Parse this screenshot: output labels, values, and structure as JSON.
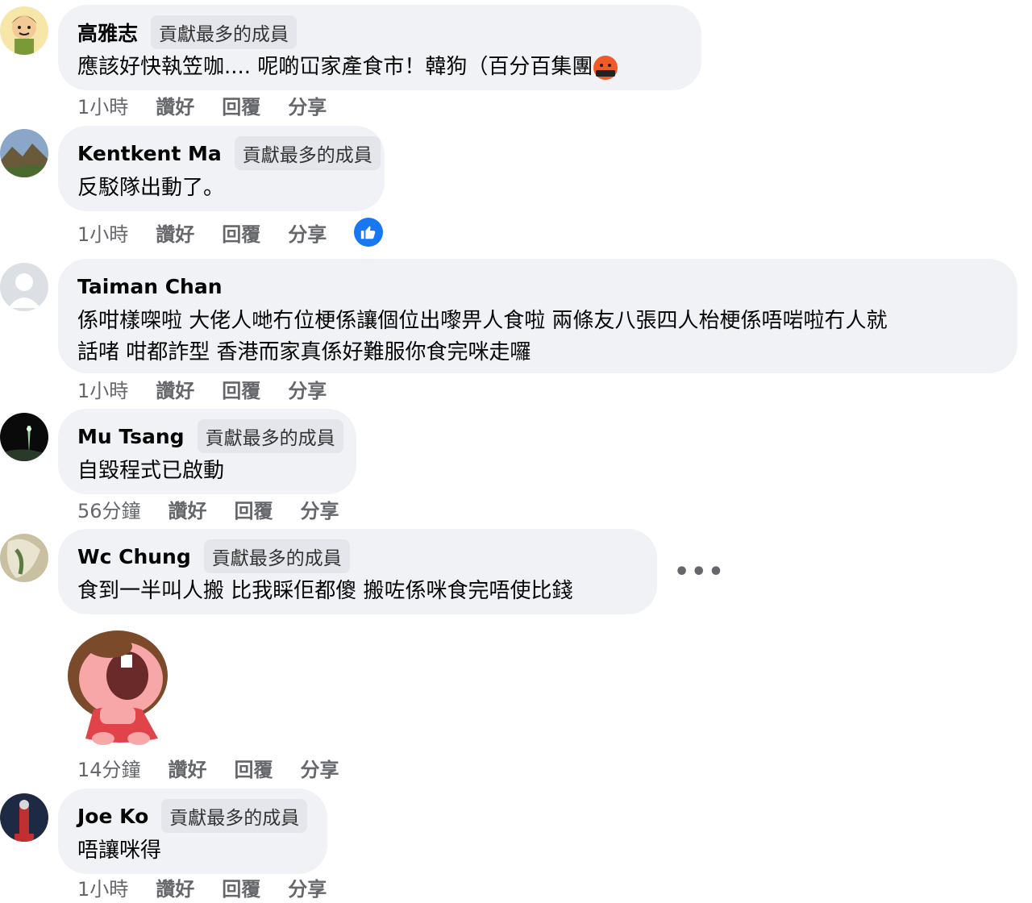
{
  "comments": [
    {
      "name": "高雅志",
      "badge": "貢獻最多的成員",
      "text": "應該好快執笠咖.... 呢啲冚家產食市！韓狗（百分百集團",
      "emoji_icon": "angry-censored-face-icon",
      "time": "1小時",
      "like": "讚好",
      "reply": "回覆",
      "share": "分享"
    },
    {
      "name": "Kentkent Ma",
      "badge": "貢獻最多的成員",
      "text": "反駁隊出動了。",
      "time": "1小時",
      "like": "讚好",
      "reply": "回覆",
      "share": "分享",
      "reaction_icon": "thumbs-up-icon"
    },
    {
      "name": "Taiman Chan",
      "text_lines": [
        "係咁樣㗎啦 大佬人哋冇位梗係讓個位出嚟畀人食啦 兩條友八張四人枱梗係唔啱啦冇人就",
        "話啫 咁都詐型 香港而家真係好難服你食完咪走囉"
      ],
      "time": "1小時",
      "like": "讚好",
      "reply": "回覆",
      "share": "分享"
    },
    {
      "name": "Mu Tsang",
      "badge": "貢獻最多的成員",
      "text": "自毀程式已啟動",
      "time": "56分鐘",
      "like": "讚好",
      "reply": "回覆",
      "share": "分享"
    },
    {
      "name": "Wc Chung",
      "badge": "貢獻最多的成員",
      "text": "食到一半叫人搬 比我睬佢都傻 搬咗係咪食完唔使比錢",
      "more": "•••",
      "sticker": "laughing-girl-sticker",
      "time": "14分鐘",
      "like": "讚好",
      "reply": "回覆",
      "share": "分享"
    },
    {
      "name": "Joe Ko",
      "badge": "貢獻最多的成員",
      "text": "唔讓咪得",
      "time": "1小時",
      "like": "讚好",
      "reply": "回覆",
      "share": "分享"
    }
  ],
  "colors": {
    "bubble": "#f0f2f5",
    "badge": "#e4e6eb",
    "meta": "#65676b",
    "like_blue": "#1877f2"
  }
}
